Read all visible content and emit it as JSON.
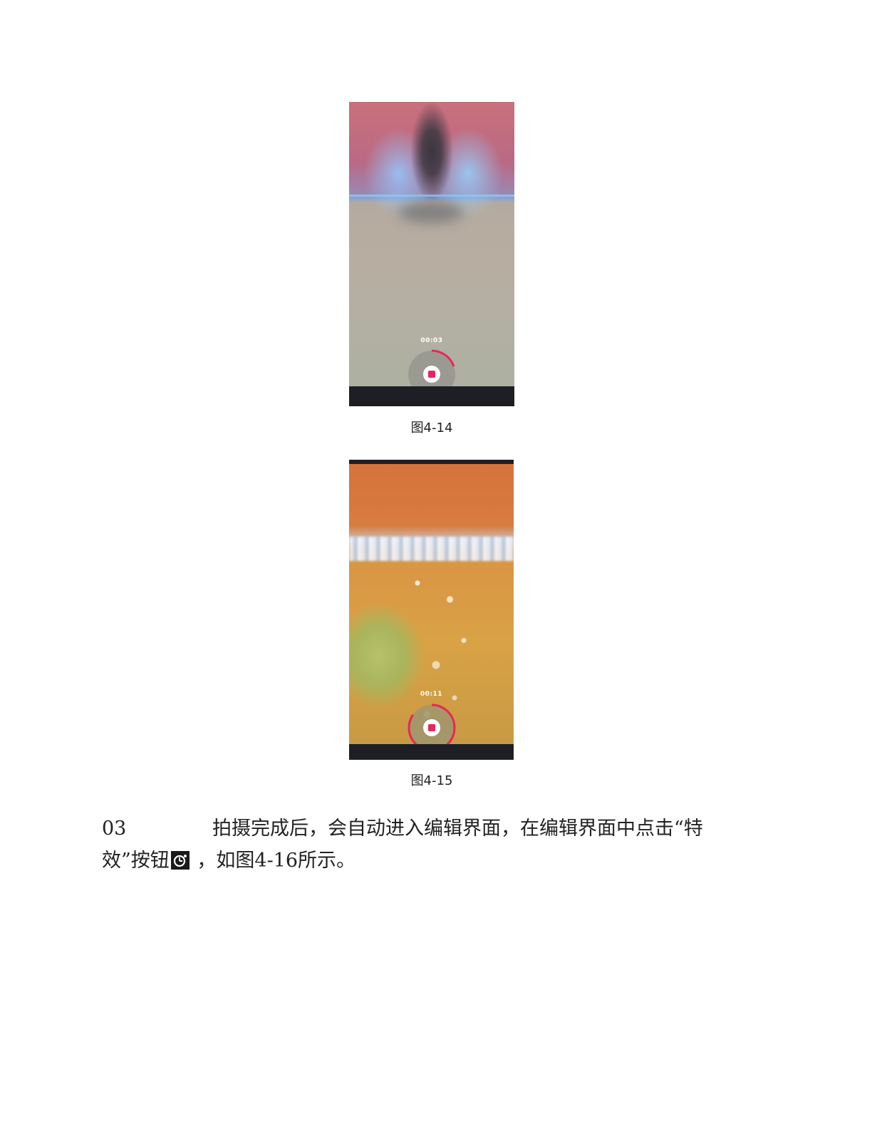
{
  "figures": [
    {
      "timer": "00:03",
      "caption": "图4-14"
    },
    {
      "timer": "00:11",
      "caption": "图4-15"
    }
  ],
  "paragraph": {
    "step": "03",
    "line1": "拍摄完成后，会自动进入编辑界面，在编辑界面中点击“特",
    "line2_before": "效”按钮",
    "line2_after": " ，如图4-16所示。"
  },
  "icons": {
    "record_stop": "stop-record-icon",
    "effects": "effects-icon"
  },
  "colors": {
    "accent": "#e8265a",
    "bar": "#1d1f24"
  }
}
